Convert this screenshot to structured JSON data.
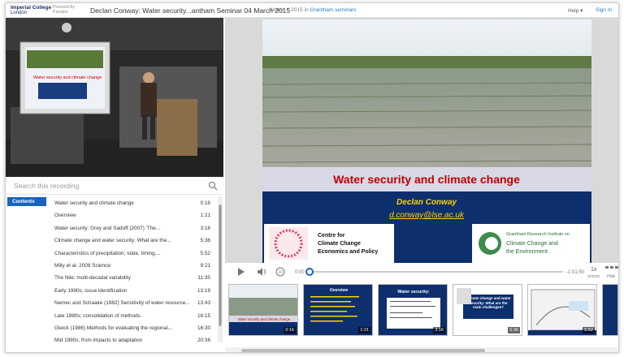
{
  "header": {
    "logo_line1": "Imperial College",
    "logo_line2": "London",
    "powered_line1": "Powered By",
    "powered_line2": "Panopto",
    "title": "Declan Conway: Water security...antham Seminar 04 March 2015",
    "date": "March 4 2015 in",
    "folder": "Grantham seminars",
    "help": "Help ▾",
    "signin": "Sign In"
  },
  "video": {
    "screen_title": "Water security and climate change"
  },
  "search": {
    "placeholder": "Search this recording"
  },
  "toc": {
    "tab": "Contents",
    "items": [
      {
        "title": "Water security and climate change",
        "time": "0:16"
      },
      {
        "title": "Overview",
        "time": "1:21"
      },
      {
        "title": "Water security: Grey and Sadoff (2007) 'The...",
        "time": "3:16"
      },
      {
        "title": "Climate change and water security: What are the...",
        "time": "5:36"
      },
      {
        "title": "Characteristics of precipitation; state, timing,...",
        "time": "5:52"
      },
      {
        "title": "Milly et al. 2008 Science",
        "time": "9:21"
      },
      {
        "title": "The Nile: multi-decadal variability",
        "time": "11:35"
      },
      {
        "title": "Early 1980s; issue identification",
        "time": "13:19"
      },
      {
        "title": "Nemec and Schaake (1982) Sensitivity of water resource...",
        "time": "13:43"
      },
      {
        "title": "Late 1980s; consolidation of methods",
        "time": "16:15"
      },
      {
        "title": "Gleick (1986) Methods for evaluating the regional...",
        "time": "16:30"
      },
      {
        "title": "Mid 1990s; from impacts to adaptation",
        "time": "20:36"
      }
    ]
  },
  "slide": {
    "title": "Water security and climate change",
    "author": "Declan Conway",
    "email": "d.conway@lse.ac.uk",
    "logo1_l1": "Centre for",
    "logo1_l2": "Climate Change",
    "logo1_l3": "Economics and Policy",
    "logo2_l1": "Grantham Research Institute on",
    "logo2_l2": "Climate Change and",
    "logo2_l3": "the Environment"
  },
  "controls": {
    "elapsed": "0:00",
    "remaining": "-1:01:50",
    "speed": "1x",
    "speed_label": "SPEED",
    "hide_label": "Hide",
    "progress": 0.0
  },
  "thumbs": [
    {
      "title": "Water security and climate change",
      "time": "0:16"
    },
    {
      "title": "Overview",
      "time": "1:21"
    },
    {
      "title": "Water security:",
      "time": "3:16"
    },
    {
      "title": "Climate change and water security: What are the main challenges?",
      "time": "5:36"
    },
    {
      "title": "",
      "time": "5:52"
    }
  ],
  "colors": {
    "accent": "#1565c0",
    "slide_blue": "#0d2f6e",
    "slide_red": "#c00000",
    "slide_yellow": "#ffd200"
  }
}
